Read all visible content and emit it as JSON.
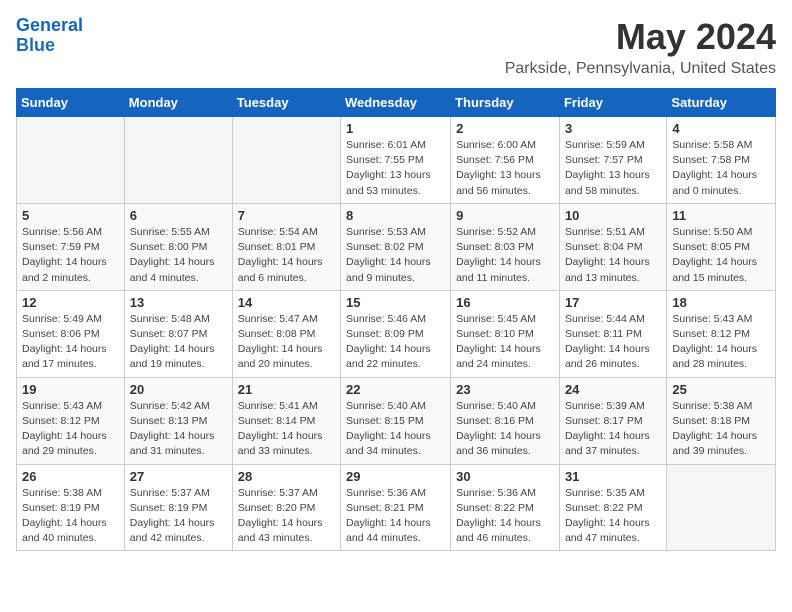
{
  "header": {
    "logo_line1": "General",
    "logo_line2": "Blue",
    "title": "May 2024",
    "subtitle": "Parkside, Pennsylvania, United States"
  },
  "days_of_week": [
    "Sunday",
    "Monday",
    "Tuesday",
    "Wednesday",
    "Thursday",
    "Friday",
    "Saturday"
  ],
  "weeks": [
    [
      {
        "num": "",
        "info": ""
      },
      {
        "num": "",
        "info": ""
      },
      {
        "num": "",
        "info": ""
      },
      {
        "num": "1",
        "info": "Sunrise: 6:01 AM\nSunset: 7:55 PM\nDaylight: 13 hours and 53 minutes."
      },
      {
        "num": "2",
        "info": "Sunrise: 6:00 AM\nSunset: 7:56 PM\nDaylight: 13 hours and 56 minutes."
      },
      {
        "num": "3",
        "info": "Sunrise: 5:59 AM\nSunset: 7:57 PM\nDaylight: 13 hours and 58 minutes."
      },
      {
        "num": "4",
        "info": "Sunrise: 5:58 AM\nSunset: 7:58 PM\nDaylight: 14 hours and 0 minutes."
      }
    ],
    [
      {
        "num": "5",
        "info": "Sunrise: 5:56 AM\nSunset: 7:59 PM\nDaylight: 14 hours and 2 minutes."
      },
      {
        "num": "6",
        "info": "Sunrise: 5:55 AM\nSunset: 8:00 PM\nDaylight: 14 hours and 4 minutes."
      },
      {
        "num": "7",
        "info": "Sunrise: 5:54 AM\nSunset: 8:01 PM\nDaylight: 14 hours and 6 minutes."
      },
      {
        "num": "8",
        "info": "Sunrise: 5:53 AM\nSunset: 8:02 PM\nDaylight: 14 hours and 9 minutes."
      },
      {
        "num": "9",
        "info": "Sunrise: 5:52 AM\nSunset: 8:03 PM\nDaylight: 14 hours and 11 minutes."
      },
      {
        "num": "10",
        "info": "Sunrise: 5:51 AM\nSunset: 8:04 PM\nDaylight: 14 hours and 13 minutes."
      },
      {
        "num": "11",
        "info": "Sunrise: 5:50 AM\nSunset: 8:05 PM\nDaylight: 14 hours and 15 minutes."
      }
    ],
    [
      {
        "num": "12",
        "info": "Sunrise: 5:49 AM\nSunset: 8:06 PM\nDaylight: 14 hours and 17 minutes."
      },
      {
        "num": "13",
        "info": "Sunrise: 5:48 AM\nSunset: 8:07 PM\nDaylight: 14 hours and 19 minutes."
      },
      {
        "num": "14",
        "info": "Sunrise: 5:47 AM\nSunset: 8:08 PM\nDaylight: 14 hours and 20 minutes."
      },
      {
        "num": "15",
        "info": "Sunrise: 5:46 AM\nSunset: 8:09 PM\nDaylight: 14 hours and 22 minutes."
      },
      {
        "num": "16",
        "info": "Sunrise: 5:45 AM\nSunset: 8:10 PM\nDaylight: 14 hours and 24 minutes."
      },
      {
        "num": "17",
        "info": "Sunrise: 5:44 AM\nSunset: 8:11 PM\nDaylight: 14 hours and 26 minutes."
      },
      {
        "num": "18",
        "info": "Sunrise: 5:43 AM\nSunset: 8:12 PM\nDaylight: 14 hours and 28 minutes."
      }
    ],
    [
      {
        "num": "19",
        "info": "Sunrise: 5:43 AM\nSunset: 8:12 PM\nDaylight: 14 hours and 29 minutes."
      },
      {
        "num": "20",
        "info": "Sunrise: 5:42 AM\nSunset: 8:13 PM\nDaylight: 14 hours and 31 minutes."
      },
      {
        "num": "21",
        "info": "Sunrise: 5:41 AM\nSunset: 8:14 PM\nDaylight: 14 hours and 33 minutes."
      },
      {
        "num": "22",
        "info": "Sunrise: 5:40 AM\nSunset: 8:15 PM\nDaylight: 14 hours and 34 minutes."
      },
      {
        "num": "23",
        "info": "Sunrise: 5:40 AM\nSunset: 8:16 PM\nDaylight: 14 hours and 36 minutes."
      },
      {
        "num": "24",
        "info": "Sunrise: 5:39 AM\nSunset: 8:17 PM\nDaylight: 14 hours and 37 minutes."
      },
      {
        "num": "25",
        "info": "Sunrise: 5:38 AM\nSunset: 8:18 PM\nDaylight: 14 hours and 39 minutes."
      }
    ],
    [
      {
        "num": "26",
        "info": "Sunrise: 5:38 AM\nSunset: 8:19 PM\nDaylight: 14 hours and 40 minutes."
      },
      {
        "num": "27",
        "info": "Sunrise: 5:37 AM\nSunset: 8:19 PM\nDaylight: 14 hours and 42 minutes."
      },
      {
        "num": "28",
        "info": "Sunrise: 5:37 AM\nSunset: 8:20 PM\nDaylight: 14 hours and 43 minutes."
      },
      {
        "num": "29",
        "info": "Sunrise: 5:36 AM\nSunset: 8:21 PM\nDaylight: 14 hours and 44 minutes."
      },
      {
        "num": "30",
        "info": "Sunrise: 5:36 AM\nSunset: 8:22 PM\nDaylight: 14 hours and 46 minutes."
      },
      {
        "num": "31",
        "info": "Sunrise: 5:35 AM\nSunset: 8:22 PM\nDaylight: 14 hours and 47 minutes."
      },
      {
        "num": "",
        "info": ""
      }
    ]
  ]
}
